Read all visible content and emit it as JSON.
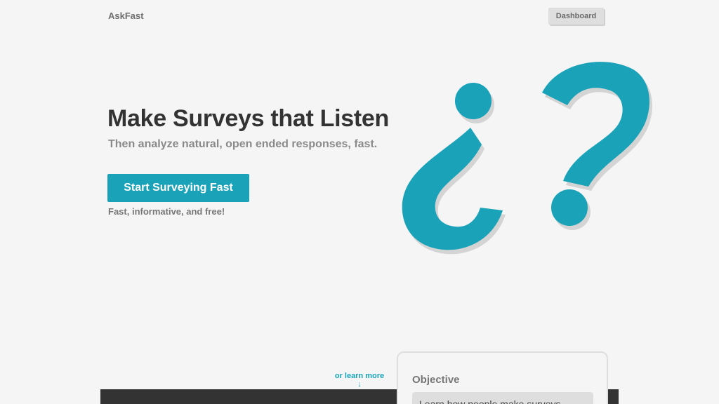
{
  "header": {
    "brand": "AskFast",
    "dashboard_label": "Dashboard"
  },
  "hero": {
    "title": "Make Surveys that Listen",
    "subtitle": "Then analyze natural, open ended responses, fast.",
    "cta_label": "Start Surveying Fast",
    "cta_note": "Fast, informative, and free!",
    "art": {
      "icon": "question-marks-icon",
      "color": "#19a2b8",
      "shadow_color": "#d4d4d4"
    }
  },
  "learn_more": {
    "label": "or learn more",
    "arrow": "↓"
  },
  "objective_card": {
    "title": "Objective",
    "value": "Learn how people make surveys"
  },
  "colors": {
    "accent": "#19a2b8",
    "background": "#f5f5f5",
    "dark_band": "#333333"
  }
}
